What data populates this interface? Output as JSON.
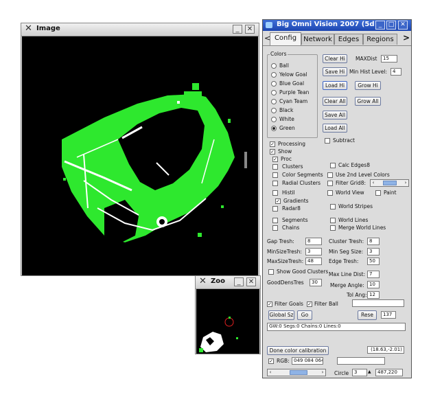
{
  "image_window": {
    "title": "Image"
  },
  "zoom_window": {
    "title": "Zoo"
  },
  "omni": {
    "title": "Big Omni Vision 2007 (5d",
    "tabs": [
      {
        "label": "Config",
        "active": true
      },
      {
        "label": "Network"
      },
      {
        "label": "Edges"
      },
      {
        "label": "Regions"
      }
    ],
    "colors_group_label": "Colors",
    "colors": [
      {
        "label": "Ball",
        "selected": false
      },
      {
        "label": "Yelow Goal",
        "selected": false
      },
      {
        "label": "Blue Goal",
        "selected": false
      },
      {
        "label": "Purple Tean",
        "selected": false
      },
      {
        "label": "Cyan Team",
        "selected": false
      },
      {
        "label": "Black",
        "selected": false
      },
      {
        "label": "White",
        "selected": false
      },
      {
        "label": "Green",
        "selected": true
      }
    ],
    "buttons": {
      "clear_hi": "Clear Hi",
      "save_hi": "Save Hi",
      "load_hi": "Load Hi",
      "grow_hi": "Grow Hi",
      "clear_all": "Clear All",
      "grow_all": "Grow All",
      "save_all": "Save All",
      "load_all": "Load All",
      "global": "Global Sz",
      "go": "Go",
      "reset": "Rese",
      "done_calib": "Done color calibration"
    },
    "fields": {
      "maxdist_label": "MAXDist",
      "maxdist": "15",
      "min_hist_label": "Min Hist Level:",
      "min_hist": "4"
    },
    "options": {
      "subtract": "Subtract",
      "processing": "Processing",
      "show": "Show",
      "proc": "Proc",
      "clusters": "Clusters",
      "calc_edges": "Calc Edges8",
      "color_segments": "Color Segments",
      "use_2nd": "Use 2nd Level Colors",
      "radial_clusters": "Radial Clusters",
      "filter_grid": "Filter Grid8:",
      "histil": "Histil",
      "world_view": "World View",
      "paint": "Paint",
      "gradients": "Gradients",
      "radar": "Radar8",
      "world_stripes": "World Stripes",
      "segments": "Segments",
      "world_lines": "World Lines",
      "chains": "Chains",
      "merge_world_lines": "Merge World Lines"
    },
    "params": {
      "gap_tresh_label": "Gap Tresh:",
      "gap_tresh": "8",
      "cluster_tresh_label": "Cluster Tresh:",
      "cluster_tresh": "8",
      "minsize_label": "MinSizeTresh:",
      "minsize": "3",
      "min_seg_label": "Min Seg Size:",
      "min_seg": "3",
      "maxsize_label": "MaxSizeTresh:",
      "maxsize": "48",
      "edge_tresh_label": "Edge Tresh:",
      "edge_tresh": "50",
      "show_good_clusters": "Show Good Clusters",
      "max_line_label": "Max Line Dist:",
      "max_line": "7",
      "good_dens_label": "GoodDensTres",
      "good_dens": "30",
      "merge_angle_label": "Merge Angle:",
      "merge_angle": "10",
      "tol_ang_label": "Tol Ang:",
      "tol_ang": "12",
      "filter_goals": "Filter Goals",
      "filter_ball": "Filter Ball",
      "reset_value": "137"
    },
    "status": "GW:0 Segs:0 Chains:0 Lines:0",
    "coords": "(18.63,-2.01)",
    "rgb_label": "RGB:",
    "rgb_value": "049 084 064",
    "circle_label": "Circle",
    "circle_value": "3",
    "pos_value": "487,220"
  },
  "colors": {
    "green": "#2ee82e",
    "omni_title_bar": "#2a55c4"
  }
}
